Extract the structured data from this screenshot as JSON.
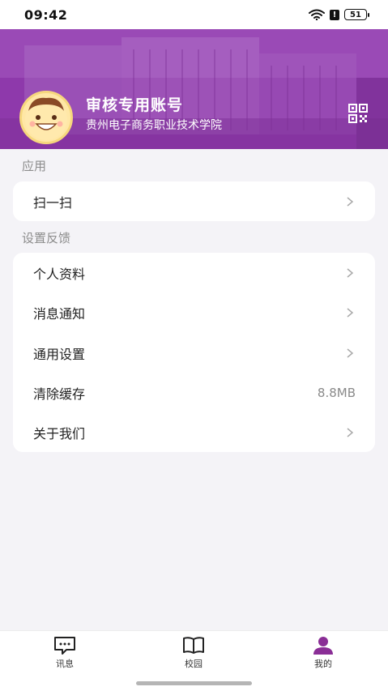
{
  "status_bar": {
    "time": "09:42",
    "battery": "51",
    "alert": "!"
  },
  "profile": {
    "name": "审核专用账号",
    "school": "贵州电子商务职业技术学院"
  },
  "sections": {
    "apps": {
      "title": "应用",
      "items": [
        {
          "label": "扫一扫"
        }
      ]
    },
    "settings": {
      "title": "设置反馈",
      "items": [
        {
          "label": "个人资料"
        },
        {
          "label": "消息通知"
        },
        {
          "label": "通用设置"
        },
        {
          "label": "清除缓存",
          "value": "8.8MB"
        },
        {
          "label": "关于我们"
        }
      ]
    }
  },
  "bottom_nav": {
    "items": [
      {
        "label": "讯息",
        "icon": "message-icon"
      },
      {
        "label": "校园",
        "icon": "book-icon"
      },
      {
        "label": "我的",
        "icon": "person-icon",
        "active": true
      }
    ]
  },
  "colors": {
    "accent": "#8a2e96",
    "header": "#9b3fb8",
    "background": "#f4f3f7"
  }
}
